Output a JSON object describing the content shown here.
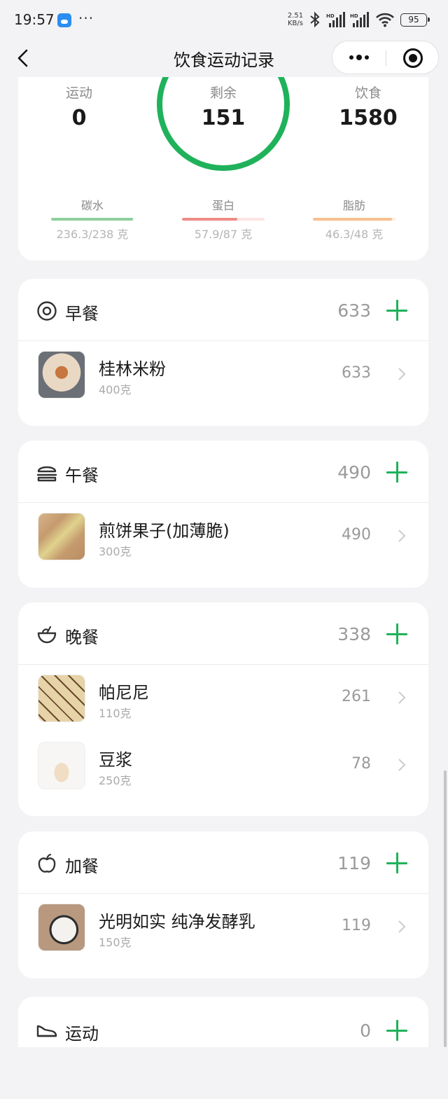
{
  "status_bar": {
    "time": "19:57",
    "more": "···",
    "net_speed_value": "2.51",
    "net_speed_unit": "KB/s",
    "battery": "95"
  },
  "nav": {
    "title": "饮食运动记录"
  },
  "summary": {
    "exercise_label": "运动",
    "exercise_value": "0",
    "remaining_label": "剩余",
    "remaining_value": "151",
    "food_label": "饮食",
    "food_value": "1580",
    "macros": [
      {
        "label": "碳水",
        "value": "236.3/238 克",
        "progress": 0.99,
        "color": "#8fcf9c",
        "track": "#e6f4e9"
      },
      {
        "label": "蛋白",
        "value": "57.9/87 克",
        "progress": 0.67,
        "color": "#ee8a85",
        "track": "#fce5e4"
      },
      {
        "label": "脂肪",
        "value": "46.3/48 克",
        "progress": 0.96,
        "color": "#f7c08f",
        "track": "#fdeedd"
      }
    ]
  },
  "meals": [
    {
      "name": "早餐",
      "total": "633",
      "icon": "egg-icon",
      "items": [
        {
          "name": "桂林米粉",
          "weight": "400克",
          "cal": "633",
          "thumb": "rice-noodle-thumbnail"
        }
      ]
    },
    {
      "name": "午餐",
      "total": "490",
      "icon": "burger-icon",
      "items": [
        {
          "name": "煎饼果子(加薄脆)",
          "weight": "300克",
          "cal": "490",
          "thumb": "pancake-thumbnail"
        }
      ]
    },
    {
      "name": "晚餐",
      "total": "338",
      "icon": "bowl-icon",
      "items": [
        {
          "name": "帕尼尼",
          "weight": "110克",
          "cal": "261",
          "thumb": "panini-thumbnail"
        },
        {
          "name": "豆浆",
          "weight": "250克",
          "cal": "78",
          "thumb": "soy-milk-thumbnail"
        }
      ]
    },
    {
      "name": "加餐",
      "total": "119",
      "icon": "apple-icon",
      "items": [
        {
          "name": "光明如实 纯净发酵乳",
          "weight": "150克",
          "cal": "119",
          "thumb": "yogurt-thumbnail"
        }
      ]
    },
    {
      "name": "运动",
      "total": "0",
      "icon": "sneaker-icon",
      "items": []
    }
  ],
  "colors": {
    "accent": "#1fb25a",
    "background": "#f3f3f5"
  }
}
